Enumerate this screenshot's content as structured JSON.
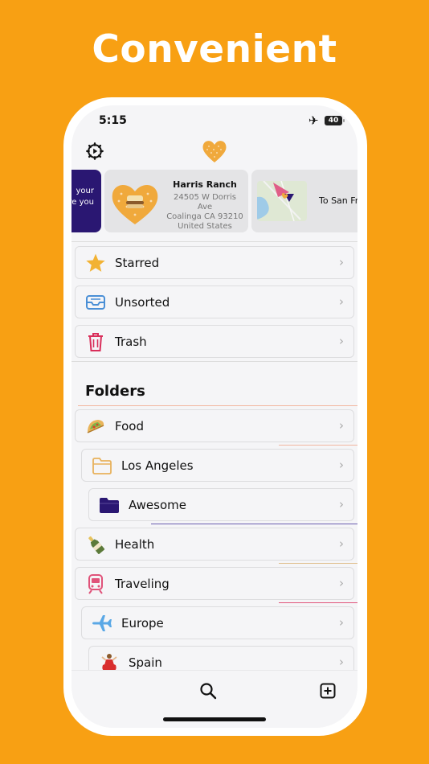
{
  "headline": "Convenient",
  "status_bar": {
    "time": "5:15",
    "battery": "40"
  },
  "carousel": {
    "partial_card_lines": [
      "your",
      "re you"
    ],
    "place_card": {
      "title": "Harris Ranch",
      "address_line1": "24505 W Dorris Ave",
      "address_line2": "Coalinga CA 93210",
      "address_line3": "United States"
    },
    "route_card": {
      "title": "To San Fra"
    }
  },
  "quick_items": [
    {
      "label": "Starred",
      "icon": "star-icon"
    },
    {
      "label": "Unsorted",
      "icon": "inbox-tray-icon"
    },
    {
      "label": "Trash",
      "icon": "trash-icon"
    }
  ],
  "folders_heading": "Folders",
  "folders": [
    {
      "label": "Food",
      "icon": "taco-icon",
      "level": 0
    },
    {
      "label": "Los Angeles",
      "icon": "folder-outline-icon",
      "level": 1
    },
    {
      "label": "Awesome",
      "icon": "folder-filled-icon",
      "level": 2
    },
    {
      "label": "Health",
      "icon": "bottle-icon",
      "level": 0
    },
    {
      "label": "Traveling",
      "icon": "train-icon",
      "level": 0
    },
    {
      "label": "Europe",
      "icon": "airplane-icon",
      "level": 1
    },
    {
      "label": "Spain",
      "icon": "dancer-icon",
      "level": 2
    }
  ],
  "colors": {
    "background": "#F8A013",
    "star": "#F2B233",
    "inbox": "#4A8FD6",
    "trash": "#D92E5A",
    "folder_outline": "#E8B25C",
    "folder_filled": "#2A1772",
    "train": "#E0537A",
    "airplane": "#5AA8E6"
  },
  "tab_bar": {
    "left_icon": "search-icon",
    "right_icon": "add-square-icon"
  }
}
